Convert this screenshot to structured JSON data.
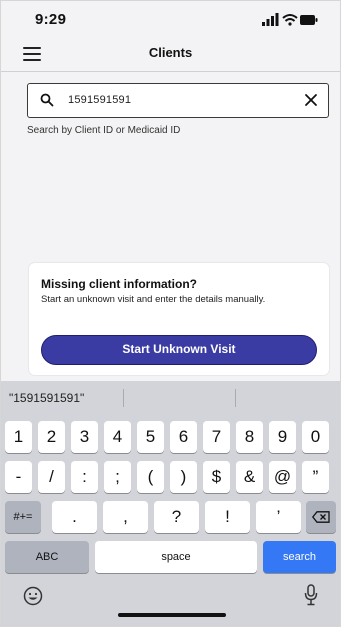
{
  "status_bar": {
    "time": "9:29"
  },
  "nav": {
    "title": "Clients",
    "menu_icon": "hamburger-menu-icon"
  },
  "search": {
    "value": "1591591591",
    "helper": "Search by Client ID or Medicaid ID",
    "search_icon": "search-icon",
    "clear_icon": "clear-icon"
  },
  "card": {
    "title": "Missing client information?",
    "body": "Start an unknown visit and enter the details manually.",
    "button_label": "Start Unknown Visit"
  },
  "keyboard": {
    "suggestion": "\"1591591591\"",
    "row1": [
      "1",
      "2",
      "3",
      "4",
      "5",
      "6",
      "7",
      "8",
      "9",
      "0"
    ],
    "row2": [
      "-",
      "/",
      ":",
      ";",
      "(",
      ")",
      "$",
      "&",
      "@",
      "”"
    ],
    "row3": [
      "#+=",
      ".",
      ",",
      "?",
      "!",
      "’"
    ],
    "abc_label": "ABC",
    "space_label": "space",
    "search_label": "search"
  },
  "colors": {
    "accent": "#3b3ca3",
    "keyboard_bg": "#d2d4d9",
    "search_key": "#3478f6"
  }
}
